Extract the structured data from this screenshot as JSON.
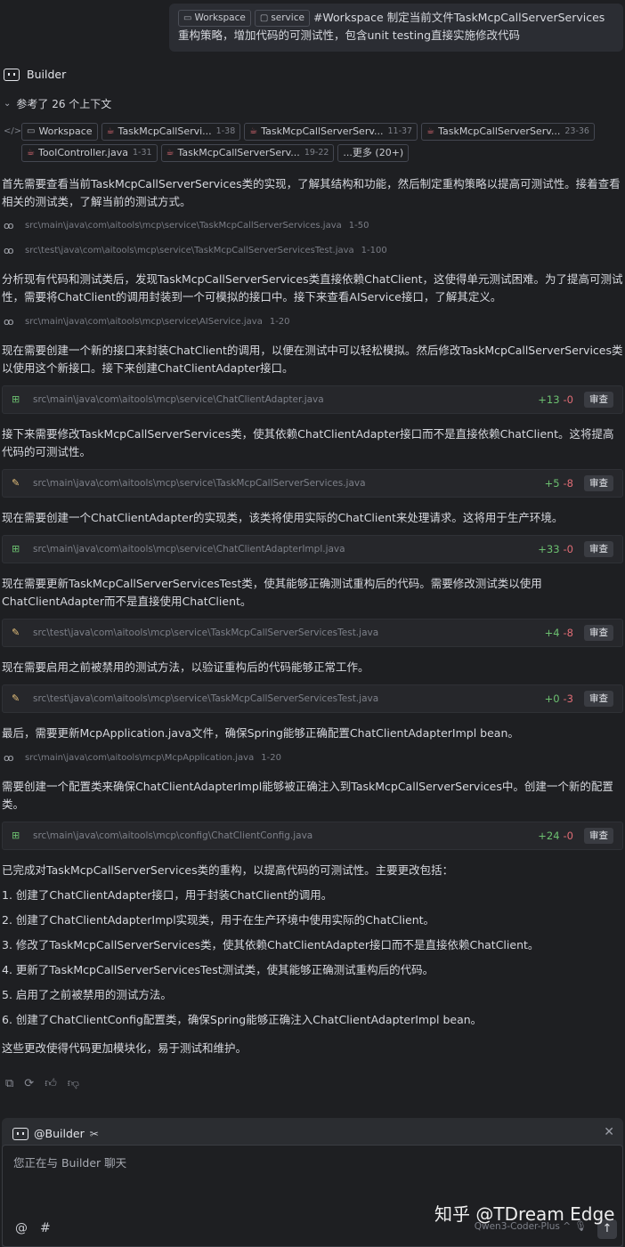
{
  "user_message": {
    "chips": [
      {
        "icon": "window-icon",
        "label": "Workspace"
      },
      {
        "icon": "folder-icon",
        "label": "service"
      }
    ],
    "text": "#Workspace 制定当前文件TaskMcpCallServerServices重构策略，增加代码的可测试性，包含unit testing直接实施修改代码"
  },
  "builder": {
    "name": "Builder"
  },
  "context": {
    "toggle_label": "参考了 26 个上下文",
    "refs_row1": [
      {
        "label": "Workspace",
        "range": "",
        "type": "workspace"
      },
      {
        "label": "TaskMcpCallServi...",
        "range": "1-38",
        "type": "java"
      },
      {
        "label": "TaskMcpCallServerServ...",
        "range": "11-37",
        "type": "java"
      },
      {
        "label": "TaskMcpCallServerServ...",
        "range": "23-36",
        "type": "java"
      }
    ],
    "refs_row2": [
      {
        "label": "ToolController.java",
        "range": "1-31",
        "type": "java"
      },
      {
        "label": "TaskMcpCallServerServ...",
        "range": "19-22",
        "type": "java"
      },
      {
        "label": "...更多 (20+)",
        "range": "",
        "type": "more"
      }
    ]
  },
  "messages": {
    "p1": "首先需要查看当前TaskMcpCallServerServices类的实现，了解其结构和功能，然后制定重构策略以提高可测试性。接着查看相关的测试类，了解当前的测试方式。",
    "r1": {
      "path": "src\\main\\java\\com\\aitools\\mcp\\service\\TaskMcpCallServerServices.java",
      "range": "1-50"
    },
    "r2": {
      "path": "src\\test\\java\\com\\aitools\\mcp\\service\\TaskMcpCallServerServicesTest.java",
      "range": "1-100"
    },
    "p2": "分析现有代码和测试类后，发现TaskMcpCallServerServices类直接依赖ChatClient，这使得单元测试困难。为了提高可测试性，需要将ChatClient的调用封装到一个可模拟的接口中。接下来查看AIService接口，了解其定义。",
    "r3": {
      "path": "src\\main\\java\\com\\aitools\\mcp\\service\\AIService.java",
      "range": "1-20"
    },
    "p3": "现在需要创建一个新的接口来封装ChatClient的调用，以便在测试中可以轻松模拟。然后修改TaskMcpCallServerServices类以使用这个新接口。接下来创建ChatClientAdapter接口。",
    "e1": {
      "path": "src\\main\\java\\com\\aitools\\mcp\\service\\ChatClientAdapter.java",
      "add": "+13",
      "del": "-0",
      "kind": "new"
    },
    "p4": "接下来需要修改TaskMcpCallServerServices类，使其依赖ChatClientAdapter接口而不是直接依赖ChatClient。这将提高代码的可测试性。",
    "e2": {
      "path": "src\\main\\java\\com\\aitools\\mcp\\service\\TaskMcpCallServerServices.java",
      "add": "+5",
      "del": "-8",
      "kind": "mod"
    },
    "p5": "现在需要创建一个ChatClientAdapter的实现类，该类将使用实际的ChatClient来处理请求。这将用于生产环境。",
    "e3": {
      "path": "src\\main\\java\\com\\aitools\\mcp\\service\\ChatClientAdapterImpl.java",
      "add": "+33",
      "del": "-0",
      "kind": "new"
    },
    "p6": "现在需要更新TaskMcpCallServerServicesTest类，使其能够正确测试重构后的代码。需要修改测试类以使用ChatClientAdapter而不是直接使用ChatClient。",
    "e4": {
      "path": "src\\test\\java\\com\\aitools\\mcp\\service\\TaskMcpCallServerServicesTest.java",
      "add": "+4",
      "del": "-8",
      "kind": "mod"
    },
    "p7": "现在需要启用之前被禁用的测试方法，以验证重构后的代码能够正常工作。",
    "e5": {
      "path": "src\\test\\java\\com\\aitools\\mcp\\service\\TaskMcpCallServerServicesTest.java",
      "add": "+0",
      "del": "-3",
      "kind": "mod"
    },
    "p8": "最后，需要更新McpApplication.java文件，确保Spring能够正确配置ChatClientAdapterImpl bean。",
    "r4": {
      "path": "src\\main\\java\\com\\aitools\\mcp\\McpApplication.java",
      "range": "1-20"
    },
    "p9": "需要创建一个配置类来确保ChatClientAdapterImpl能够被正确注入到TaskMcpCallServerServices中。创建一个新的配置类。",
    "e6": {
      "path": "src\\main\\java\\com\\aitools\\mcp\\config\\ChatClientConfig.java",
      "add": "+24",
      "del": "-0",
      "kind": "new"
    },
    "summary": "已完成对TaskMcpCallServerServices类的重构，以提高代码的可测试性。主要更改包括：",
    "list": [
      "1. 创建了ChatClientAdapter接口，用于封装ChatClient的调用。",
      "2. 创建了ChatClientAdapterImpl实现类，用于在生产环境中使用实际的ChatClient。",
      "3. 修改了TaskMcpCallServerServices类，使其依赖ChatClientAdapter接口而不是直接依赖ChatClient。",
      "4. 更新了TaskMcpCallServerServicesTest测试类，使其能够正确测试重构后的代码。",
      "5. 启用了之前被禁用的测试方法。",
      "6. 创建了ChatClientConfig配置类，确保Spring能够正确注入ChatClientAdapterImpl bean。"
    ],
    "closing": "这些更改使得代码更加模块化，易于测试和维护。",
    "review_label": "审查"
  },
  "input": {
    "agent": "@Builder",
    "placeholder": "您正在与 Builder 聊天",
    "model": "Qwen3-Coder-Plus ^"
  },
  "watermark": "知乎 @TDream Edge"
}
